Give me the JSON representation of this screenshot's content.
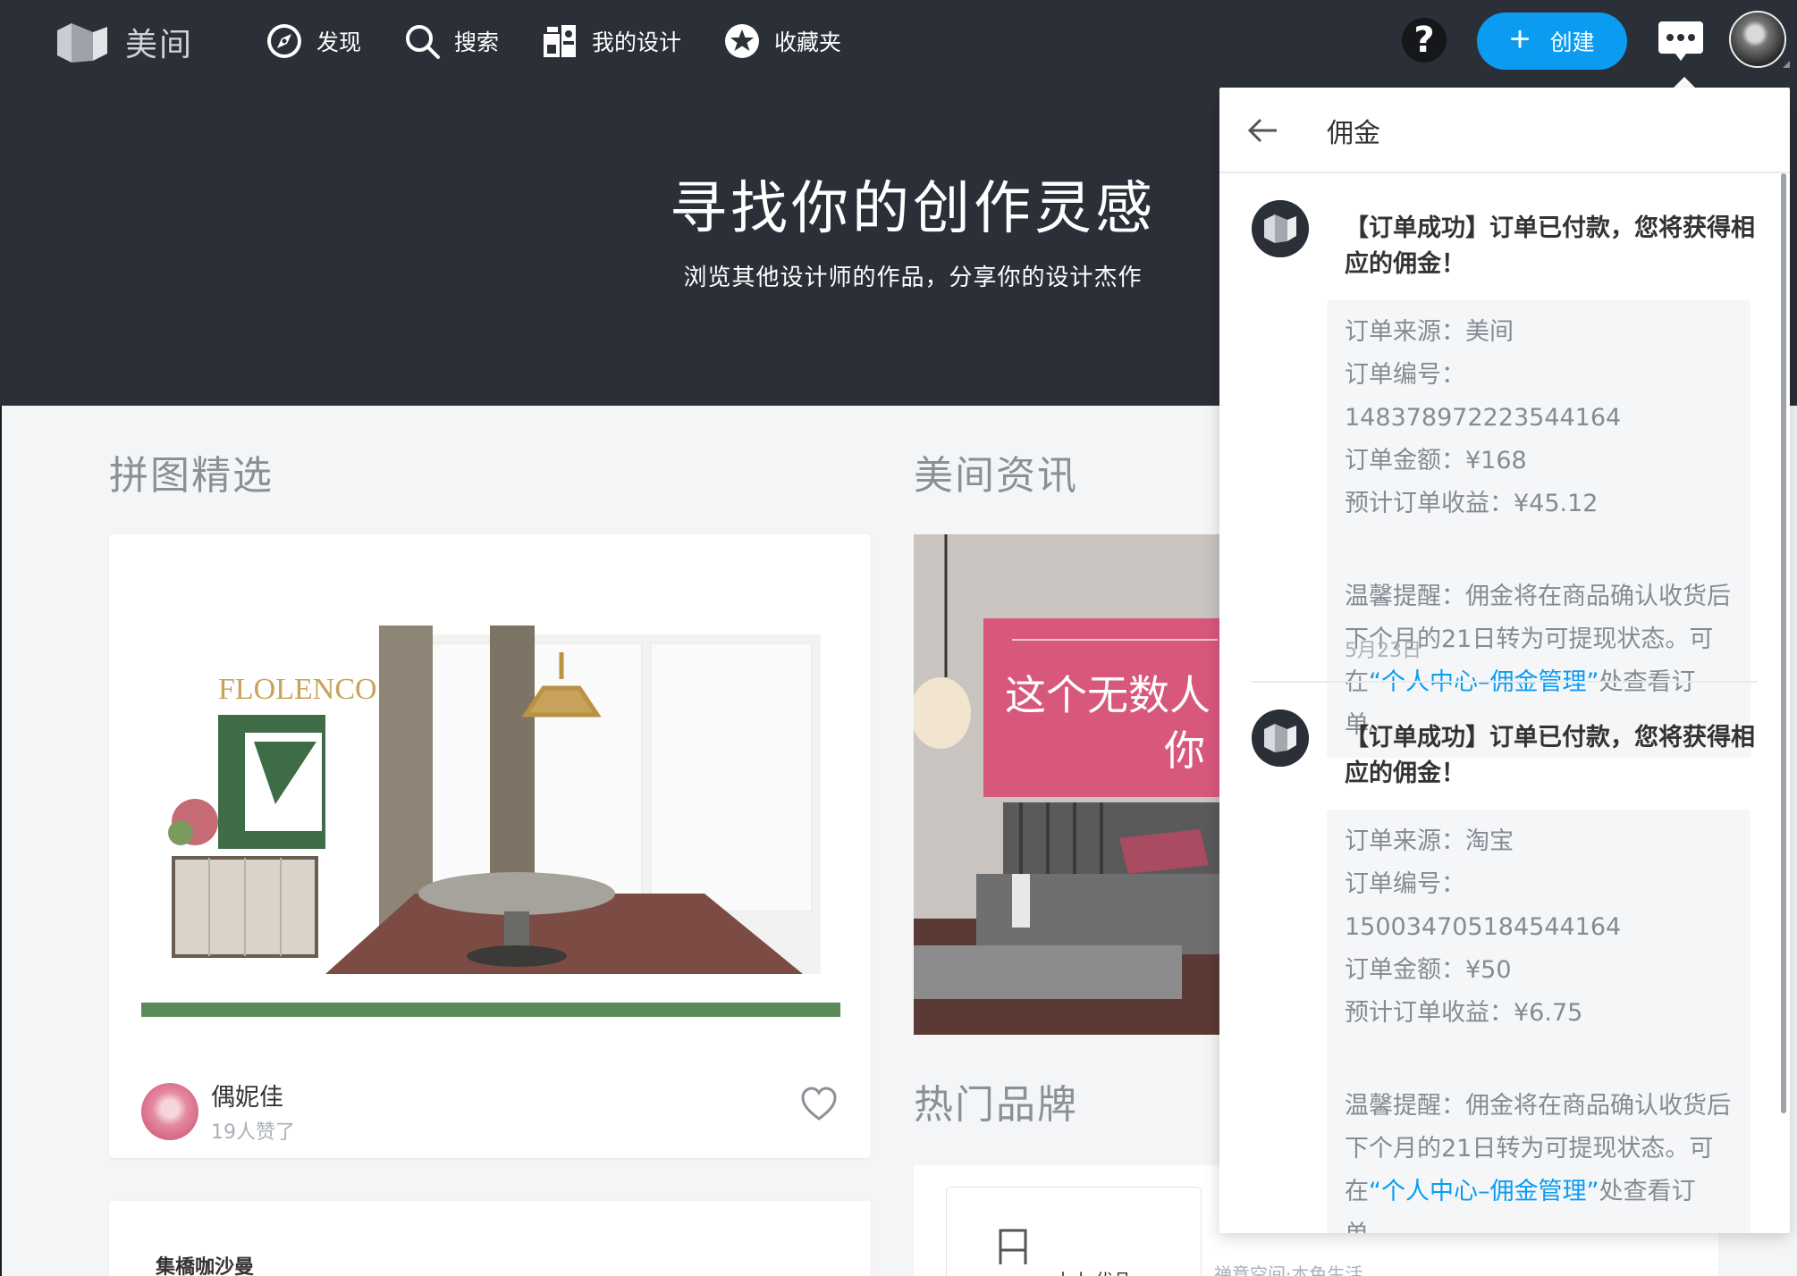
{
  "app": {
    "name": "美间"
  },
  "nav": {
    "discover": "发现",
    "search": "搜索",
    "my_designs": "我的设计",
    "favorites": "收藏夹",
    "help": "?",
    "create": "创建"
  },
  "hero": {
    "title": "寻找你的创作灵感",
    "subtitle": "浏览其他设计师的作品，分享你的设计杰作"
  },
  "sections": {
    "collage_title": "拼图精选",
    "news_title": "美间资讯",
    "brands_title": "热门品牌"
  },
  "collage_card": {
    "brand_text": "FLOLENCO",
    "author": "偶妮佳",
    "likes": "19人赞了"
  },
  "collage_card2": {
    "brand_text": "集橋咖沙曼"
  },
  "news_card": {
    "headline_line1": "这个无数人",
    "headline_line2": "你"
  },
  "brand_card": {
    "label": "大小·优品",
    "sub": "禅意空间·本色生活"
  },
  "panel": {
    "title": "佣金",
    "notifications": [
      {
        "title": "【订单成功】订单已付款，您将获得相应的佣金！",
        "source": "订单来源：美间",
        "order_no": "订单编号：148378972223544164",
        "amount": "订单金额：¥168",
        "earning": "预计订单收益：¥45.12",
        "tip_a": "温馨提醒：佣金将在商品确认收货后下个月的21日转为可提现状态。可在",
        "tip_link": "“个人中心–佣金管理”",
        "tip_b": "处查看订单。",
        "date": "5月23日"
      },
      {
        "title": "【订单成功】订单已付款，您将获得相应的佣金！",
        "source": "订单来源：淘宝",
        "order_no": "订单编号：150034705184544164",
        "amount": "订单金额：¥50",
        "earning": "预计订单收益：¥6.75",
        "tip_a": "温馨提醒：佣金将在商品确认收货后下个月的21日转为可提现状态。可在",
        "tip_link": "“个人中心–佣金管理”",
        "tip_b": "处查看订单。"
      }
    ]
  },
  "colors": {
    "topbar": "#2b2f38",
    "accent": "#0b9cf2",
    "background": "#f4f5f7"
  }
}
